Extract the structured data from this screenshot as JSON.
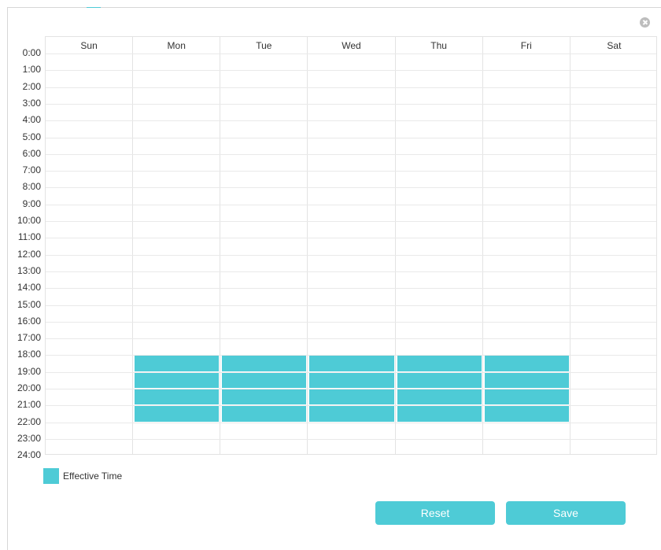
{
  "schedule": {
    "days": [
      "Sun",
      "Mon",
      "Tue",
      "Wed",
      "Thu",
      "Fri",
      "Sat"
    ],
    "hours": [
      "0:00",
      "1:00",
      "2:00",
      "3:00",
      "4:00",
      "5:00",
      "6:00",
      "7:00",
      "8:00",
      "9:00",
      "10:00",
      "11:00",
      "12:00",
      "13:00",
      "14:00",
      "15:00",
      "16:00",
      "17:00",
      "18:00",
      "19:00",
      "20:00",
      "21:00",
      "22:00",
      "23:00",
      "24:00"
    ],
    "effective_slots": [
      {
        "day": "Mon",
        "hours": [
          18,
          19,
          20,
          21
        ]
      },
      {
        "day": "Tue",
        "hours": [
          18,
          19,
          20,
          21
        ]
      },
      {
        "day": "Wed",
        "hours": [
          18,
          19,
          20,
          21
        ]
      },
      {
        "day": "Thu",
        "hours": [
          18,
          19,
          20,
          21
        ]
      },
      {
        "day": "Fri",
        "hours": [
          18,
          19,
          20,
          21
        ]
      }
    ],
    "effective_color": "#4ecbd6"
  },
  "legend": {
    "effective_label": "Effective Time"
  },
  "buttons": {
    "reset_label": "Reset",
    "save_label": "Save"
  },
  "icons": {
    "close": "close-icon"
  }
}
